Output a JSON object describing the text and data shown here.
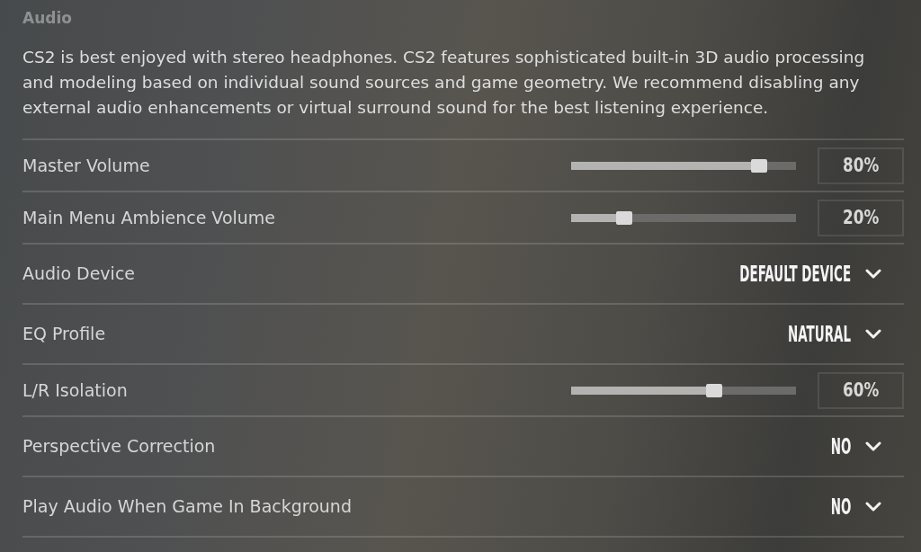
{
  "section": {
    "title": "Audio",
    "description": "CS2 is best enjoyed with stereo headphones. CS2 features sophisticated built-in 3D audio processing and modeling based on individual sound sources and game geometry. We recommend disabling any external audio enhancements or virtual surround sound for the best listening experience."
  },
  "settings": [
    {
      "kind": "slider",
      "label": "Master Volume",
      "level": 0.8,
      "reading": "80%"
    },
    {
      "kind": "slider",
      "label": "Main Menu Ambience Volume",
      "level": 0.2,
      "reading": "20%"
    },
    {
      "kind": "dropdown",
      "label": "Audio Device",
      "value": "DEFAULT DEVICE"
    },
    {
      "kind": "dropdown",
      "label": "EQ Profile",
      "value": "NATURAL"
    },
    {
      "kind": "slider",
      "label": "L/R Isolation",
      "level": 0.6,
      "reading": "60%"
    },
    {
      "kind": "dropdown",
      "label": "Perspective Correction",
      "value": "NO"
    },
    {
      "kind": "dropdown",
      "label": "Play Audio When Game In Background",
      "value": "NO"
    }
  ]
}
